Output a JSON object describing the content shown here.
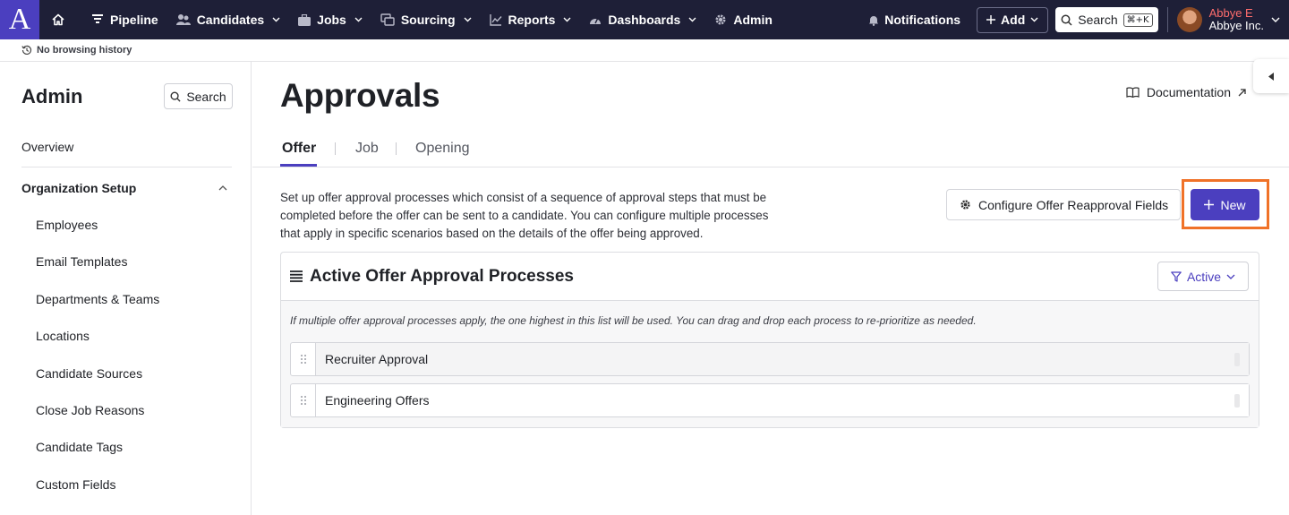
{
  "topnav": {
    "logo": "A",
    "items": [
      {
        "label": "Pipeline"
      },
      {
        "label": "Candidates"
      },
      {
        "label": "Jobs"
      },
      {
        "label": "Sourcing"
      },
      {
        "label": "Reports"
      },
      {
        "label": "Dashboards"
      },
      {
        "label": "Admin"
      }
    ],
    "notifications": "Notifications",
    "add": "Add",
    "search": "Search",
    "shortcut": "⌘+K",
    "user_name": "Abbye E",
    "user_org": "Abbye Inc."
  },
  "history": {
    "text": "No browsing history"
  },
  "sidebar": {
    "title": "Admin",
    "search": "Search",
    "overview": "Overview",
    "section": "Organization Setup",
    "items": [
      "Employees",
      "Email Templates",
      "Departments & Teams",
      "Locations",
      "Candidate Sources",
      "Close Job Reasons",
      "Candidate Tags",
      "Custom Fields"
    ]
  },
  "main": {
    "title": "Approvals",
    "doc_link": "Documentation",
    "tabs": [
      "Offer",
      "Job",
      "Opening"
    ],
    "description": "Set up offer approval processes which consist of a sequence of approval steps that must be completed before the offer can be sent to a candidate. You can configure multiple processes that apply in specific scenarios based on the details of the offer being approved.",
    "configure_button": "Configure Offer Reapproval Fields",
    "new_button": "New",
    "panel": {
      "title": "Active Offer Approval Processes",
      "filter": "Active",
      "hint": "If multiple offer approval processes apply, the one highest in this list will be used. You can drag and drop each process to re-prioritize as needed.",
      "processes": [
        "Recruiter Approval",
        "Engineering Offers"
      ]
    }
  },
  "colors": {
    "nav_bg": "#1e1f37",
    "accent": "#4b3fbf",
    "highlight": "#f07228",
    "user_name": "#ff6d6d"
  }
}
